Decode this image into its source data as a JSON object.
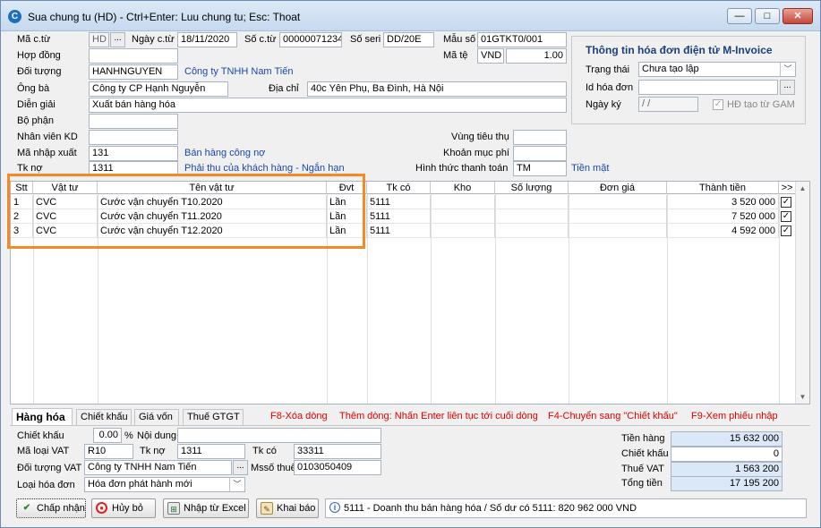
{
  "window": {
    "title": "Sua chung tu (HD) - Ctrl+Enter: Luu chung tu; Esc: Thoat",
    "min": "—",
    "max": "□",
    "close": "✕"
  },
  "header": {
    "ma_ct_label": "Mã c.từ",
    "ma_ct_value": "HD",
    "ngay_ct_label": "Ngày c.từ",
    "ngay_ct_value": "18/11/2020",
    "so_ct_label": "Số c.từ",
    "so_ct_value": "00000071234",
    "so_seri_label": "Số seri",
    "so_seri_value": "DD/20E",
    "mau_so_label": "Mẫu số",
    "mau_so_value": "01GTKT0/001",
    "hop_dong_label": "Hợp đồng",
    "hop_dong_value": "",
    "ma_te_label": "Mã tệ",
    "ma_te_value": "VND",
    "ty_gia_value": "1.00",
    "doi_tuong_label": "Đối tượng",
    "doi_tuong_value": "HANHNGUYEN",
    "doi_tuong_name": "Công ty TNHH Nam Tiến",
    "ong_ba_label": "Ông bà",
    "ong_ba_value": "Công ty CP Hạnh Nguyễn",
    "dia_chi_label": "Địa chỉ",
    "dia_chi_value": "40c Yên Phụ, Ba Đình, Hà Nội",
    "dien_giai_label": "Diễn giải",
    "dien_giai_value": "Xuất bán hàng hóa",
    "bo_phan_label": "Bộ phận",
    "bo_phan_value": "",
    "nhan_vien_label": "Nhân viên KD",
    "nhan_vien_value": "",
    "vung_tieu_thu_label": "Vùng tiêu thụ",
    "vung_tieu_thu_value": "",
    "ma_nhap_xuat_label": "Mã nhập xuất",
    "ma_nhap_xuat_value": "131",
    "ma_nhap_xuat_name": "Bán hàng công nợ",
    "khoan_muc_phi_label": "Khoản mục phí",
    "khoan_muc_phi_value": "",
    "tk_no_label": "Tk nợ",
    "tk_no_value": "1311",
    "tk_no_name": "Phải thu của khách hàng - Ngắn hạn",
    "httt_label": "Hình thức thanh toán",
    "httt_value": "TM",
    "httt_name": "Tiền mặt"
  },
  "einvoice": {
    "title": "Thông tin hóa đơn điện tử M-Invoice",
    "trang_thai_label": "Trạng thái",
    "trang_thai_value": "Chưa tạo lập",
    "id_label": "Id hóa đơn",
    "id_value": "",
    "ngay_ky_label": "Ngày ký",
    "ngay_ky_value": "/ /",
    "hd_tao_label": "HĐ tạo từ GAM"
  },
  "grid": {
    "headers": [
      "Stt",
      "Vật tư",
      "Tên vật tư",
      "Đvt",
      "Tk có",
      "Kho",
      "Số lượng",
      "Đơn giá",
      "Thành tiền",
      ">>"
    ],
    "rows": [
      {
        "stt": "1",
        "vat_tu": "CVC",
        "ten": "Cước vận chuyển T10.2020",
        "dvt": "Lần",
        "tk_co": "5111",
        "kho": "",
        "so_luong": "",
        "don_gia": "",
        "thanh_tien": "3 520 000",
        "checked": "✓"
      },
      {
        "stt": "2",
        "vat_tu": "CVC",
        "ten": "Cước vận chuyển T11.2020",
        "dvt": "Lần",
        "tk_co": "5111",
        "kho": "",
        "so_luong": "",
        "don_gia": "",
        "thanh_tien": "7 520 000",
        "checked": "✓"
      },
      {
        "stt": "3",
        "vat_tu": "CVC",
        "ten": "Cước vận chuyển T12.2020",
        "dvt": "Lần",
        "tk_co": "5111",
        "kho": "",
        "so_luong": "",
        "don_gia": "",
        "thanh_tien": "4 592 000",
        "checked": "✓"
      }
    ],
    "scroll_up": "▲",
    "scroll_down": "▼"
  },
  "tabs": [
    "Hàng hóa",
    "Chiết khấu",
    "Giá vốn",
    "Thuế GTGT"
  ],
  "hints": {
    "f8": "F8-Xóa dòng",
    "enter": "Thêm dòng: Nhấn Enter liên tục tới cuối dòng",
    "f4": "F4-Chuyển sang \"Chiết khấu\"",
    "f9": "F9-Xem phiếu nhập"
  },
  "footer": {
    "chiet_khau_label": "Chiết khấu",
    "chiet_khau_value": "0.00",
    "pct": "%",
    "noi_dung_label": "Nội dung",
    "noi_dung_value": "",
    "ma_loai_vat_label": "Mã loại VAT",
    "ma_loai_vat_value": "R10",
    "tk_no_label": "Tk nợ",
    "tk_no_value": "1311",
    "tk_co_label": "Tk có",
    "tk_co_value": "33311",
    "doi_tuong_vat_label": "Đối tượng VAT",
    "doi_tuong_vat_value": "Công ty TNHH Nam Tiến",
    "mst_label": "Mssố thuế",
    "mst_value": "0103050409",
    "loai_hd_label": "Loại hóa đơn",
    "loai_hd_value": "Hóa đơn phát hành mới"
  },
  "totals": {
    "tien_hang_label": "Tiền hàng",
    "tien_hang_value": "15 632 000",
    "chiet_khau_label": "Chiết khấu",
    "chiet_khau_value": "0",
    "thue_vat_label": "Thuế VAT",
    "thue_vat_value": "1 563 200",
    "tong_tien_label": "Tổng tiền",
    "tong_tien_value": "17 195 200"
  },
  "buttons": {
    "chap_nhan": "Chấp nhận",
    "huy_bo": "Hủy bỏ",
    "nhap_excel": "Nhập từ Excel",
    "khai_bao": "Khai báo"
  },
  "status": "5111 - Doanh thu bán hàng hóa / Số dư có 5111: 820 962 000 VND",
  "colors": {
    "highlight": "#f28a25",
    "link": "#1a47a8",
    "hint": "#e00000",
    "total_bg": "#dbe8f7"
  }
}
